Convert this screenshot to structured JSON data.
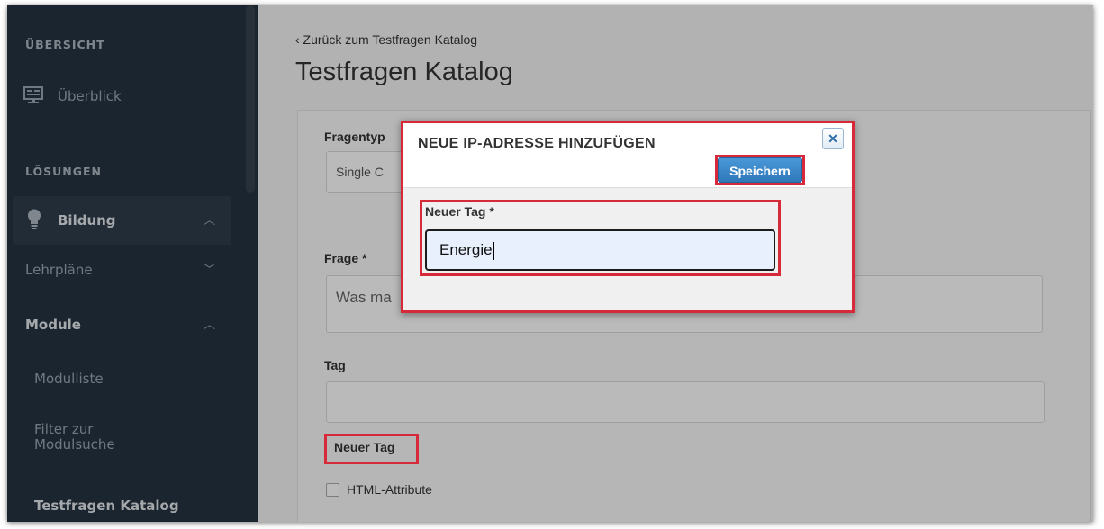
{
  "sidebar": {
    "section_overview": "ÜBERSICHT",
    "overview_item": "Überblick",
    "section_solutions": "LÖSUNGEN",
    "education": "Bildung",
    "curricula": "Lehrpläne",
    "modules": "Module",
    "module_list": "Modulliste",
    "module_filter_line1": "Filter zur",
    "module_filter_line2": "Modulsuche",
    "question_catalog": "Testfragen Katalog"
  },
  "main": {
    "back_link": "‹ Zurück zum Testfragen Katalog",
    "title": "Testfragen Katalog",
    "question_type_label": "Fragentyp",
    "question_type_value": "Single C",
    "question_label": "Frage *",
    "question_value": "Was ma",
    "tag_label": "Tag",
    "tag_value": "",
    "new_tag_link": "Neuer Tag",
    "html_attributes_label": "HTML-Attribute"
  },
  "modal": {
    "title": "NEUE IP-ADRESSE HINZUFÜGEN",
    "close_glyph": "✕",
    "save_label": "Speichern",
    "field_label": "Neuer Tag *",
    "field_value": "Energie"
  },
  "colors": {
    "sidebar_bg": "#263341",
    "highlight": "#d62a3a",
    "primary_button": "#3a86c8"
  }
}
